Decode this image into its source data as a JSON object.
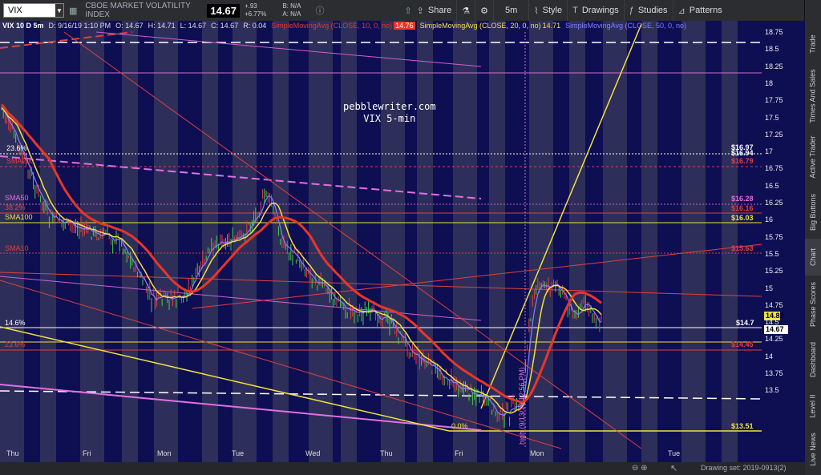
{
  "toolbar": {
    "symbol": "VIX",
    "full_name": "CBOE MARKET VOLATILITY INDEX",
    "last": "14.67",
    "net_change": "+.93",
    "pct_change": "+6.77%",
    "bid": "B: N/A",
    "ask": "A: N/A",
    "share": "Share",
    "timeframe": "5m",
    "style": "Style",
    "drawings": "Drawings",
    "studies": "Studies",
    "patterns": "Patterns"
  },
  "infobar": {
    "title": "VIX 10 D 5m",
    "date": "D: 9/16/19 1:10 PM",
    "open": "O: 14.67",
    "high": "H: 14.71",
    "low": "L: 14.67",
    "close": "C: 14.67",
    "range": "R: 0.04",
    "sma10": "SimpleMovingAvg (CLOSE, 10, 0, no)",
    "sma10_val": "14.76",
    "sma20": "SimpleMovingAvg (CLOSE, 20, 0, no)",
    "sma20_val": "14.71",
    "sma50": "SimpleMovingAvg (CLOSE, 50, 0, no)"
  },
  "watermark": {
    "line1": "pebblewriter.com",
    "line2": "VIX 5-min"
  },
  "sidebar": [
    "Trade",
    "Times And Sales",
    "Active Trader",
    "Big Buttons",
    "Chart",
    "Phase Scores",
    "Dashboard",
    "Level II",
    "Live News"
  ],
  "sidebar_active": "Chart",
  "x_labels": [
    "Thu",
    "Fri",
    "Mon",
    "Tue",
    "Wed",
    "Thu",
    "Fri",
    "Mon",
    "Tue"
  ],
  "y_labels": [
    "18.75",
    "18.5",
    "18.25",
    "18",
    "17.75",
    "17.5",
    "17.25",
    "17",
    "16.75",
    "16.5",
    "16.25",
    "16",
    "15.75",
    "15.5",
    "15.25",
    "15",
    "14.75",
    "14.5",
    "14.25",
    "14",
    "13.75",
    "13.5"
  ],
  "right_labels": {
    "r1697": "$16.97",
    "r1694": "$16.94",
    "r1679": "$16.79",
    "r1628": "$16.28",
    "r1616": "$16.16",
    "r1603": "$16.03",
    "r1563": "$15.63",
    "r147": "$14.7",
    "r1445": "$14.45",
    "r1351": "$13.51",
    "p1482": "14.82",
    "p1467": "14.67"
  },
  "left_labels": {
    "fib236": "23.6%",
    "sma200": "SMA200",
    "sma50": "SMA50",
    "fib382": "38.2%",
    "sma100": "SMA100",
    "sma10": "SMA10",
    "lvl146": "14.6%",
    "fib236b": "23.6%",
    "fib0": "0.0%"
  },
  "annotation": "high (9/13/19 12:56 PM)",
  "status": "Drawing set: 2019-0913(2)",
  "colors": {
    "background": "#0e0e52",
    "band": "#3a3a5e",
    "sma10": "#e8362a",
    "sma20": "#f0e040",
    "sma50": "#8080ff",
    "white_line": "#ffffff",
    "pink": "#e060e0"
  }
}
